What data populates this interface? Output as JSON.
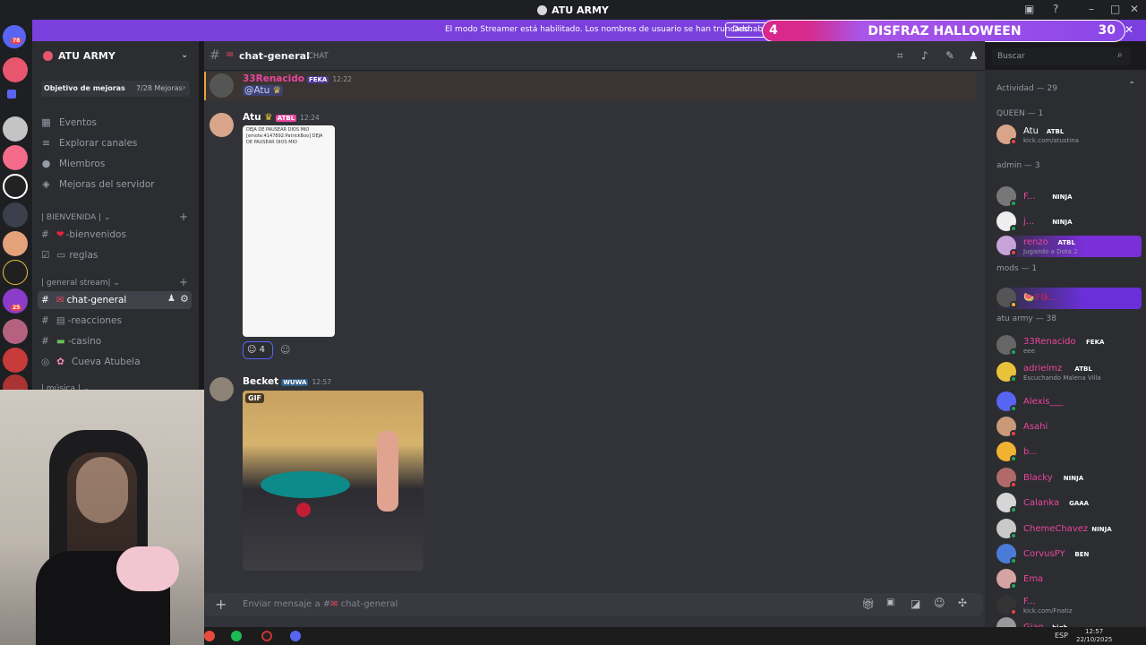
{
  "window": {
    "title": "ATU ARMY"
  },
  "banner": {
    "text": "El modo Streamer está habilitado. Los nombres de usuario se han truncado.",
    "button": "Deshabilitar"
  },
  "overlay": {
    "left_number": "4",
    "title": "DISFRAZ HALLOWEEN",
    "right_number": "30"
  },
  "guilds": {
    "badge_top": "78",
    "badge_bottom": "25"
  },
  "sidebar": {
    "server_name": "ATU ARMY",
    "goal_label": "Objetivo de mejoras",
    "goal_progress": "7/28 Mejoras",
    "goal_fraction": 0.25,
    "nav": [
      "Eventos",
      "Explorar canales",
      "Miembros",
      "Mejoras del servidor"
    ],
    "categories": [
      "| BIENVENIDA |",
      "| general stream|",
      "| música |"
    ],
    "channels": {
      "bienvenidos": "-bienvenidos",
      "reglas": "reglas",
      "chat_general": "chat-general",
      "reacciones": "-reacciones",
      "casino": "-casino",
      "cueva": "Cueva Atubela"
    }
  },
  "header": {
    "channel": "chat-general",
    "type": "CHAT",
    "search_placeholder": "Buscar"
  },
  "messages": [
    {
      "author": "33Renacido",
      "tag": "FEKA",
      "time": "12:22",
      "content": "@Atu"
    },
    {
      "author": "Atu",
      "tag": "ATBL",
      "time": "12:24",
      "reaction_count": "4",
      "image_lines": [
        "DEJA DE PAUSEAR DIOS MIO",
        "[emote:4147892:PatrickBoo] DEJA",
        "DE PAUSEAR DIOS MIO"
      ]
    },
    {
      "author": "Becket",
      "tag": "WUWA",
      "time": "12:57",
      "gif_label": "GIF"
    }
  ],
  "input": {
    "placeholder": "Enviar mensaje a #"
  },
  "members": {
    "activity": "Actividad — 29",
    "groups": [
      {
        "label": "QUEEN — 1"
      },
      {
        "label": "admin — 3"
      },
      {
        "label": "mods — 1"
      },
      {
        "label": "atu army — 38"
      }
    ],
    "list": [
      {
        "name": "Atu",
        "tag": "ATBL",
        "sub": "kick.com/atustina",
        "color": "#ffffff"
      },
      {
        "name": "F...",
        "tag": "NINJA",
        "sub": "",
        "color": "#eb459e"
      },
      {
        "name": "j...",
        "tag": "NINJA",
        "sub": "",
        "color": "#eb459e"
      },
      {
        "name": "renzo",
        "tag": "ATBL",
        "sub": "Jugando a Dota 2",
        "color": "#eb459e"
      },
      {
        "name": "🍉𝔽𝕝𝕜...",
        "tag": "",
        "sub": "",
        "color": "#e8253c"
      },
      {
        "name": "33Renacido",
        "tag": "FEKA",
        "sub": "eee",
        "color": "#eb459e"
      },
      {
        "name": "adrielmz",
        "tag": "ATBL",
        "sub": "Escuchando Malena Villa",
        "color": "#eb459e"
      },
      {
        "name": "Alexis___",
        "tag": "",
        "sub": "",
        "color": "#eb459e"
      },
      {
        "name": "Asahi",
        "tag": "",
        "sub": "",
        "color": "#eb459e"
      },
      {
        "name": "b...",
        "tag": "",
        "sub": "",
        "color": "#eb459e"
      },
      {
        "name": "Blacky",
        "tag": "NINJA",
        "sub": "",
        "color": "#eb459e"
      },
      {
        "name": "Calanka",
        "tag": "GAAA",
        "sub": "",
        "color": "#eb459e"
      },
      {
        "name": "ChemeChavez",
        "tag": "NINJA",
        "sub": "",
        "color": "#eb459e"
      },
      {
        "name": "CorvusPY",
        "tag": "BEN",
        "sub": "",
        "color": "#eb459e"
      },
      {
        "name": "Ema",
        "tag": "",
        "sub": "",
        "color": "#eb459e"
      },
      {
        "name": "F...",
        "tag": "",
        "sub": "kick.com/Fnatiz",
        "color": "#eb459e"
      },
      {
        "name": "Gian",
        "tag": "high",
        "sub": "",
        "color": "#eb459e"
      }
    ]
  },
  "taskbar": {
    "lang": "ESP",
    "time": "12:57",
    "date": "22/10/2025"
  }
}
